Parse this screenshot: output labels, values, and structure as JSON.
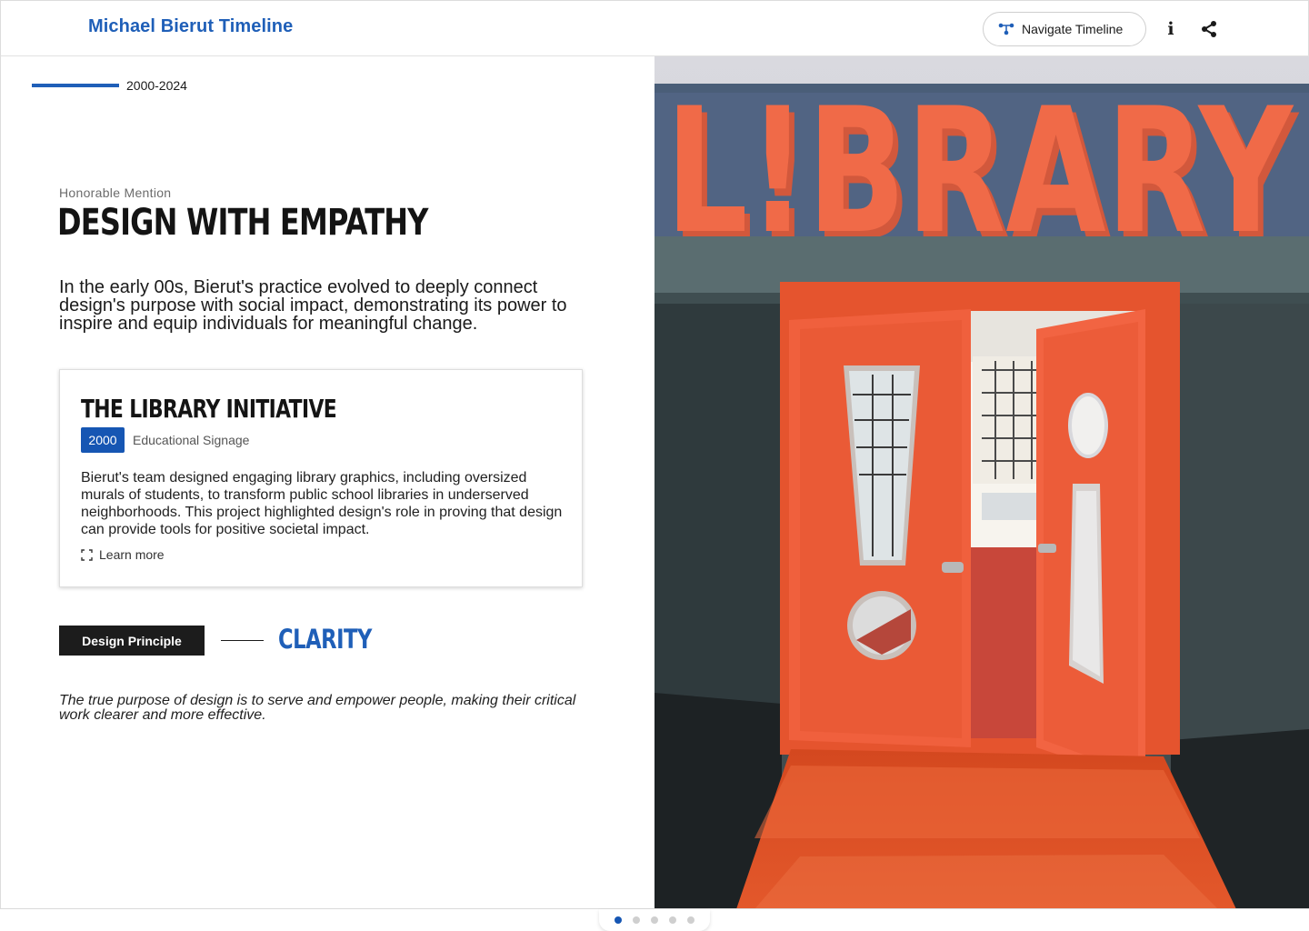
{
  "header": {
    "app_title": "Michael Bierut Timeline",
    "navigate_label": "Navigate Timeline",
    "info_label": "i"
  },
  "section": {
    "year_range": "2000-2024",
    "kicker": "Honorable Mention",
    "headline": "DESIGN WITH EMPATHY",
    "intro": "In the early 00s, Bierut's practice evolved to deeply connect design's purpose with social impact, demonstrating its power to inspire and equip individuals for meaningful change."
  },
  "project": {
    "title": "THE LIBRARY INITIATIVE",
    "year": "2000",
    "category": "Educational Signage",
    "description": "Bierut's team designed engaging library graphics, including oversized murals of students, to transform public school libraries in underserved neighborhoods. This project highlighted design's role in proving that design can provide tools for positive societal impact.",
    "learn_more": "Learn more"
  },
  "principle": {
    "tag": "Design Principle",
    "value": "CLARITY",
    "quote": "The true purpose of design is to serve and empower people, making their critical work clearer and more effective."
  },
  "photo": {
    "sign_text": "L!BRARY"
  },
  "pagination": {
    "total": 5,
    "active_index": 1
  },
  "colors": {
    "accent": "#1f5fb8",
    "badge": "#1656b3",
    "dark": "#1c1c1c",
    "door_orange": "#e85a3a"
  },
  "icons": {
    "navigate": "timeline-nodes-icon",
    "info": "info-icon",
    "share": "share-icon",
    "learn_more": "expand-icon"
  }
}
